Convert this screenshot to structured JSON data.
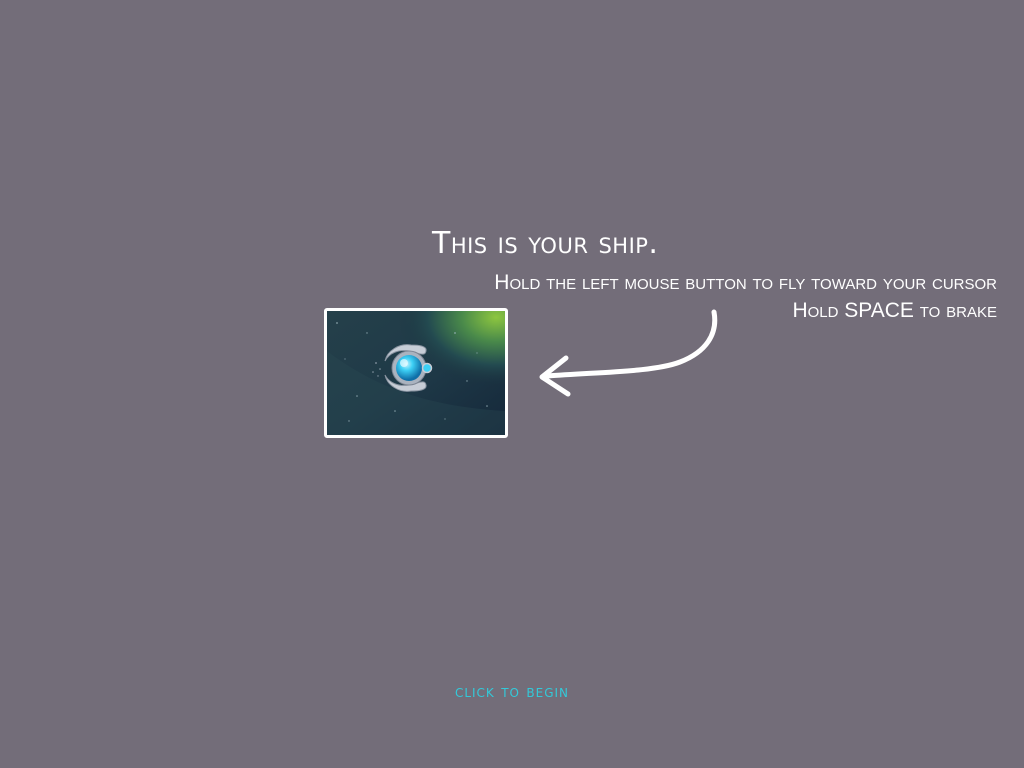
{
  "tutorial": {
    "title": "This is your ship.",
    "instruction_fly": "Hold the left mouse button to fly toward your cursor",
    "instruction_brake": "Hold SPACE to brake"
  },
  "actions": {
    "begin_label": "CLICK TO BEGIN"
  },
  "icons": {
    "ship": "player-ship-icon",
    "arrow": "curved-arrow-icon"
  },
  "colors": {
    "background": "#736d79",
    "text": "#ffffff",
    "accent": "#33c9d9",
    "ship_core": "#29b8e8"
  }
}
